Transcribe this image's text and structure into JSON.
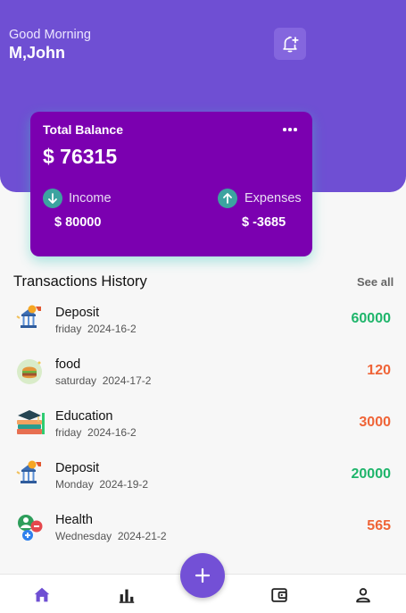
{
  "header": {
    "greeting": "Good Morning",
    "username": "M,John"
  },
  "balance_card": {
    "title": "Total Balance",
    "amount": "$ 76315",
    "income_label": "Income",
    "income_value": "$ 80000",
    "expenses_label": "Expenses",
    "expenses_value": "$ -3685"
  },
  "transactions": {
    "title": "Transactions History",
    "see_all": "See all",
    "items": [
      {
        "name": "Deposit",
        "day": "friday",
        "date": "2024-16-2",
        "amount": "60000",
        "icon": "deposit-icon"
      },
      {
        "name": "food",
        "day": "saturday",
        "date": "2024-17-2",
        "amount": "120",
        "icon": "food-icon"
      },
      {
        "name": "Education",
        "day": "friday",
        "date": "2024-16-2",
        "amount": "3000",
        "icon": "education-icon"
      },
      {
        "name": "Deposit",
        "day": "Monday",
        "date": "2024-19-2",
        "amount": "20000",
        "icon": "deposit-icon"
      },
      {
        "name": "Health",
        "day": "Wednesday",
        "date": "2024-21-2",
        "amount": "565",
        "icon": "health-icon"
      }
    ]
  },
  "nav": {
    "items": [
      "home-icon",
      "stats-icon",
      "wallet-icon",
      "profile-icon"
    ],
    "fab": "+"
  },
  "colors": {
    "header": "#6f4fd3",
    "card": "#7b00b0",
    "positive": "#1fb56b",
    "negative": "#ef6437",
    "accent": "#7350d6"
  }
}
